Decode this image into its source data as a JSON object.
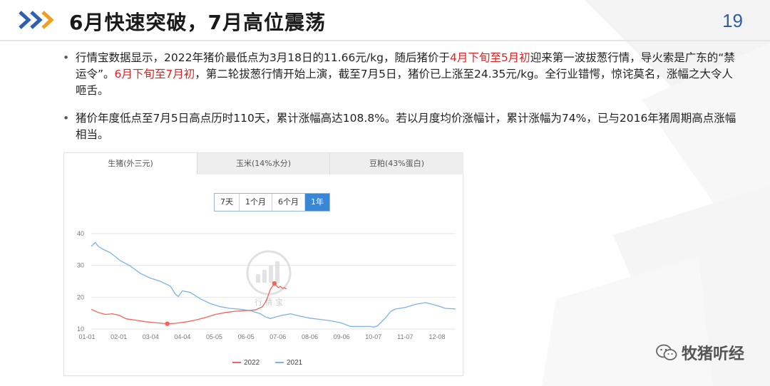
{
  "header": {
    "title": "6月快速突破，7月高位震荡",
    "page_number": "19"
  },
  "bullets": [
    {
      "segments": [
        {
          "text": "行情宝数据显示，2022年猪价最低点为3月18日的11.66元/kg，随后猪价于",
          "hl": false
        },
        {
          "text": "4月下旬至5月初",
          "hl": true
        },
        {
          "text": "迎来第一波拔葱行情，导火索是广东的“禁运令”。",
          "hl": false
        },
        {
          "text": "6月下旬至7月初",
          "hl": true
        },
        {
          "text": "，第二轮拔葱行情开始上演，截至7月5日，猪价已上涨至24.35元/kg。全行业错愕，惊诧莫名，涨幅之大令人咂舌。",
          "hl": false
        }
      ]
    },
    {
      "segments": [
        {
          "text": "猪价年度低点至7月5日高点历时110天，累计涨幅高达108.8%。若以月度均价涨幅计，累计涨幅为74%，已与2016年猪周期高点涨幅相当。",
          "hl": false
        }
      ]
    }
  ],
  "chart_tabs": [
    "生猪(外三元)",
    "玉米(14%水分)",
    "豆粕(43%蛋白)"
  ],
  "range_buttons": [
    "7天",
    "1个月",
    "6个月",
    "1年"
  ],
  "range_active": "1年",
  "watermark": {
    "text": "行 情 宝"
  },
  "footer_watermark": "牧猪听经",
  "chart_data": {
    "type": "line",
    "x_ticks": [
      "01-01",
      "02-01",
      "03-04",
      "04-04",
      "05-05",
      "06-05",
      "07-06",
      "08-06",
      "09-06",
      "10-07",
      "11-07",
      "12-08"
    ],
    "y_ticks": [
      10,
      20,
      30,
      40
    ],
    "ylim": [
      10,
      40
    ],
    "grid": true,
    "legend_position": "bottom-center",
    "series": [
      {
        "name": "2022",
        "color": "#f0645a",
        "x": [
          1,
          8,
          15,
          22,
          29,
          36,
          45,
          55,
          65,
          75,
          77,
          85,
          95,
          105,
          115,
          125,
          135,
          145,
          155,
          165,
          172,
          176,
          180,
          184,
          186,
          188,
          190,
          192,
          194,
          196
        ],
        "values": [
          16.2,
          15.2,
          14.6,
          14.8,
          14.3,
          13.2,
          12.8,
          12.3,
          12.0,
          11.7,
          11.66,
          11.8,
          12.2,
          12.8,
          13.6,
          14.6,
          15.2,
          15.6,
          15.8,
          16.0,
          17.0,
          19.0,
          22.5,
          24.35,
          23.6,
          23.0,
          23.4,
          22.8,
          23.0,
          22.6
        ],
        "markers": [
          {
            "x": 77,
            "y": 11.66
          },
          {
            "x": 184,
            "y": 24.35
          }
        ]
      },
      {
        "name": "2021",
        "color": "#7fb2df",
        "x": [
          1,
          5,
          8,
          12,
          20,
          30,
          40,
          50,
          60,
          70,
          80,
          85,
          88,
          92,
          100,
          110,
          120,
          130,
          140,
          150,
          160,
          170,
          175,
          180,
          190,
          200,
          210,
          220,
          230,
          240,
          250,
          260,
          270,
          280,
          283,
          287,
          295,
          300,
          305,
          315,
          325,
          335,
          345,
          355,
          365
        ],
        "values": [
          36.0,
          37.2,
          36.0,
          35.2,
          34.0,
          31.5,
          29.8,
          27.5,
          26.0,
          25.0,
          23.5,
          21.0,
          20.2,
          22.0,
          21.5,
          19.5,
          18.0,
          17.0,
          16.5,
          16.2,
          15.8,
          14.8,
          13.8,
          13.3,
          14.2,
          14.8,
          14.0,
          13.4,
          13.0,
          12.6,
          12.0,
          10.8,
          10.8,
          10.8,
          10.6,
          11.0,
          13.5,
          15.5,
          16.3,
          16.8,
          17.8,
          18.3,
          17.5,
          16.5,
          16.3
        ]
      }
    ]
  }
}
